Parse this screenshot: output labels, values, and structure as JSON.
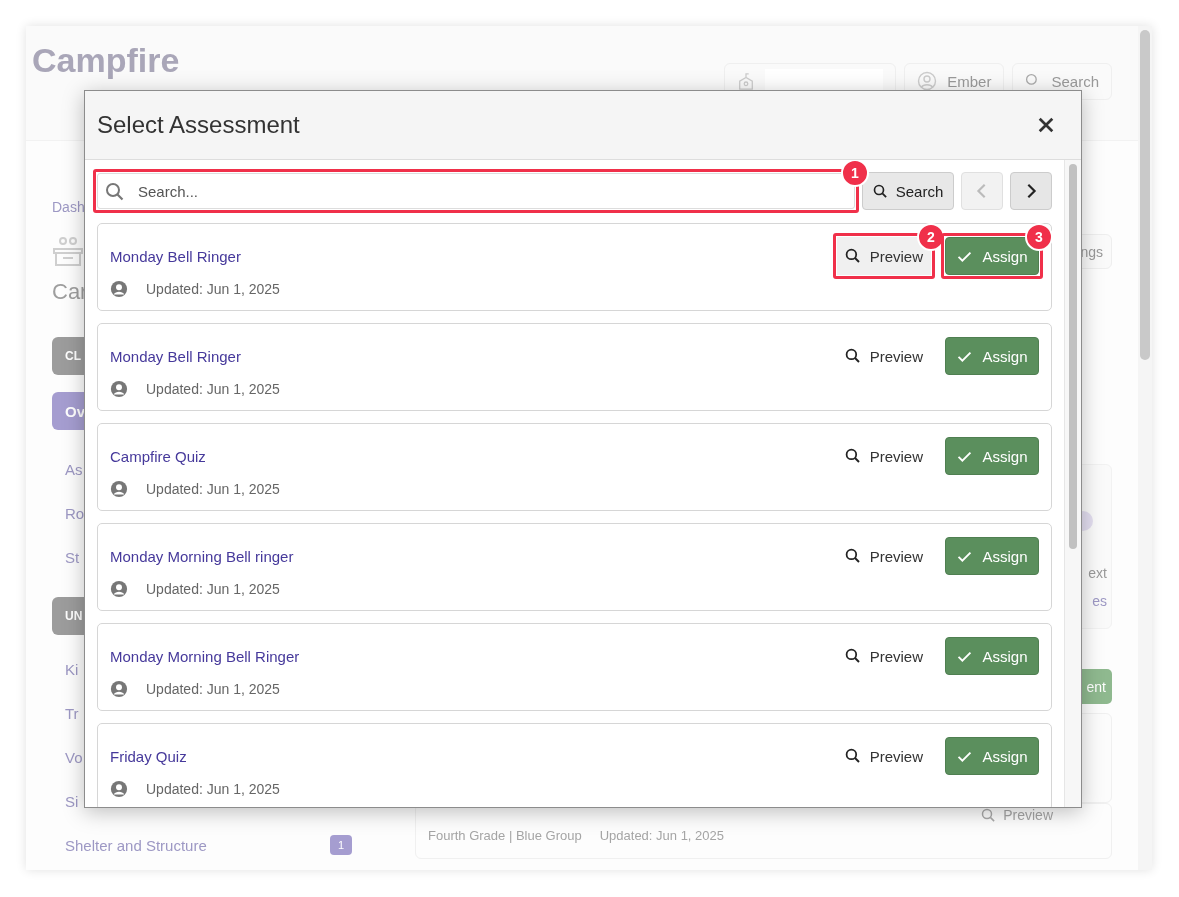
{
  "background": {
    "logo": "Campfire",
    "header_buttons": [
      {
        "kind": "school"
      },
      {
        "kind": "user",
        "label": "Ember"
      },
      {
        "kind": "search",
        "label": "Search"
      }
    ],
    "sidebar": [
      {
        "kind": "crumb",
        "label": "Dash"
      },
      {
        "kind": "icon"
      },
      {
        "kind": "heading",
        "label": "Car"
      },
      {
        "kind": "section",
        "label": "CL"
      },
      {
        "kind": "link",
        "label": "Ov",
        "selected": true
      },
      {
        "kind": "link",
        "label": "As",
        "selected": false
      },
      {
        "kind": "link",
        "label": "Ro",
        "selected": false
      },
      {
        "kind": "link",
        "label": "St",
        "selected": false
      },
      {
        "kind": "section",
        "label": "UN"
      },
      {
        "kind": "link",
        "label": "Ki",
        "selected": false
      },
      {
        "kind": "link",
        "label": "Tr",
        "selected": false
      },
      {
        "kind": "link",
        "label": "Vo",
        "selected": false
      },
      {
        "kind": "link",
        "label": "Si",
        "selected": false
      },
      {
        "kind": "link",
        "label": "Shelter and Structure",
        "selected": false,
        "badge": "1"
      }
    ],
    "main": {
      "settings_button": "ngs",
      "card": {
        "line": "ext",
        "link": "es"
      },
      "green_button": "ent",
      "assessment": {
        "group": "Fourth Grade | Blue Group",
        "updated": "Updated: Jun 1, 2025",
        "preview": "Preview"
      }
    }
  },
  "modal": {
    "title": "Select Assessment",
    "search": {
      "placeholder": "Search...",
      "callout": "1"
    },
    "search_button": "Search",
    "prev": {
      "disabled": true
    },
    "next": {
      "disabled": false
    },
    "items": [
      {
        "title": "Monday Bell Ringer",
        "updated": "Updated: Jun 1, 2025",
        "preview": "Preview",
        "assign": "Assign",
        "preview_callout": "2",
        "assign_callout": "3"
      },
      {
        "title": "Monday Bell Ringer",
        "updated": "Updated: Jun 1, 2025",
        "preview": "Preview",
        "assign": "Assign"
      },
      {
        "title": "Campfire Quiz",
        "updated": "Updated: Jun 1, 2025",
        "preview": "Preview",
        "assign": "Assign"
      },
      {
        "title": "Monday Morning Bell ringer",
        "updated": "Updated: Jun 1, 2025",
        "preview": "Preview",
        "assign": "Assign"
      },
      {
        "title": "Monday Morning Bell Ringer",
        "updated": "Updated: Jun 1, 2025",
        "preview": "Preview",
        "assign": "Assign"
      },
      {
        "title": "Friday Quiz",
        "updated": "Updated: Jun 1, 2025",
        "preview": "Preview",
        "assign": "Assign"
      }
    ]
  }
}
